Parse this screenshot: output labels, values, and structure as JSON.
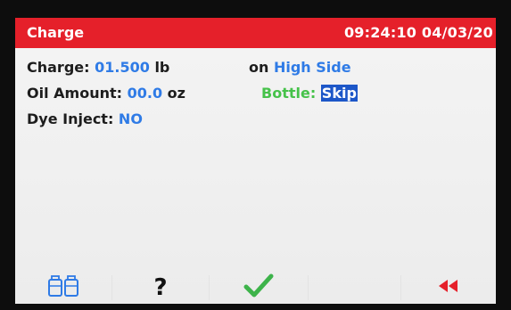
{
  "header": {
    "title": "Charge",
    "datetime": "09:24:10 04/03/20"
  },
  "fields": {
    "charge_label": "Charge:",
    "charge_value": "01.500",
    "charge_unit": "lb",
    "side_prefix": "on",
    "side_value": "High Side",
    "oil_label": "Oil Amount:",
    "oil_value": "00.0",
    "oil_unit": "oz",
    "bottle_label": "Bottle:",
    "bottle_value": "Skip",
    "dye_label": "Dye Inject:",
    "dye_value": "NO"
  },
  "toolbar": {
    "buttons": [
      {
        "icon": "bottles-icon"
      },
      {
        "icon": "help-icon",
        "label": "?"
      },
      {
        "icon": "checkmark-icon",
        "label": "✓"
      },
      {
        "icon": "back-icon",
        "label": "◀◀"
      }
    ]
  },
  "colors": {
    "header_bg": "#e5202a",
    "value_blue": "#2f7be6",
    "bottle_green": "#46c24a",
    "selection_bg": "#1d57c8"
  }
}
